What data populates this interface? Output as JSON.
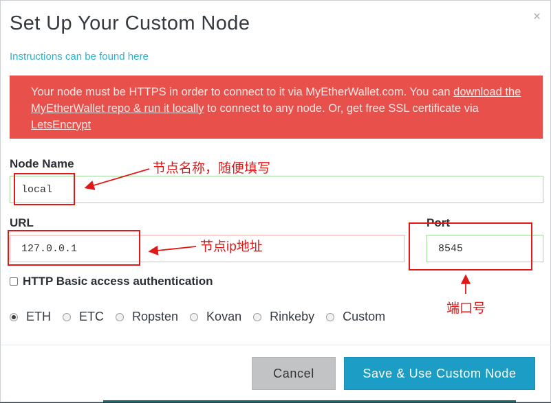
{
  "modal": {
    "title": "Set Up Your Custom Node",
    "close_icon": "×",
    "instructions_link": "Instructions can be found here",
    "alert": {
      "text1": "Your node must be HTTPS in order to connect to it via MyEtherWallet.com. You can ",
      "link1": "download the MyEtherWallet repo & run it locally",
      "text2": " to connect to any node. Or, get free SSL certificate via ",
      "link2": "LetsEncrypt"
    },
    "node_name": {
      "label": "Node Name",
      "value": "local"
    },
    "url": {
      "label": "URL",
      "value": "127.0.0.1"
    },
    "port": {
      "label": "Port",
      "value": "8545"
    },
    "http_auth": {
      "label": "HTTP Basic access authentication",
      "checked": false
    },
    "networks": [
      {
        "label": "ETH",
        "checked": true
      },
      {
        "label": "ETC",
        "checked": false
      },
      {
        "label": "Ropsten",
        "checked": false
      },
      {
        "label": "Kovan",
        "checked": false
      },
      {
        "label": "Rinkeby",
        "checked": false
      },
      {
        "label": "Custom",
        "checked": false
      }
    ],
    "buttons": {
      "cancel": "Cancel",
      "save": "Save & Use Custom Node"
    }
  },
  "annotations": {
    "node_name_note": "节点名称，随便填写",
    "url_note": "节点ip地址",
    "port_note": "端口号",
    "color": "#e01818"
  },
  "colors": {
    "alert_bg": "#e8514b",
    "link": "#2bb2c9",
    "primary_button": "#1c9dc5",
    "valid_border": "#9fd89b",
    "invalid_border": "#f2b0ac"
  }
}
